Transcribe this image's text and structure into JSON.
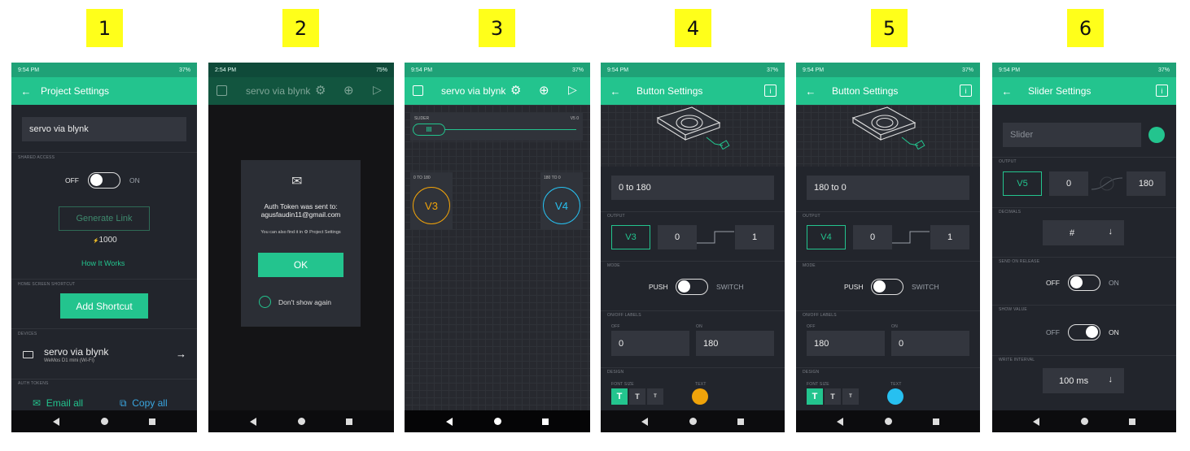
{
  "badges": [
    "1",
    "2",
    "3",
    "4",
    "5",
    "6"
  ],
  "colors": {
    "accent": "#23c48e",
    "badge": "#ffff1a",
    "orange": "#f0a30a",
    "blue": "#27c0f0"
  },
  "p1": {
    "status_time": "9:54 PM",
    "status_right": "37%",
    "title": "Project Settings",
    "project_name": "servo via blynk",
    "shared_access_label": "SHARED ACCESS",
    "off": "OFF",
    "on": "ON",
    "generate_link": "Generate Link",
    "energy": "1000",
    "how_it_works": "How It Works",
    "home_shortcut_label": "HOME SCREEN SHORTCUT",
    "add_shortcut": "Add Shortcut",
    "devices_label": "DEVICES",
    "device_name": "servo via blynk",
    "device_model": "WeMos D1 mini (Wi-Fi)",
    "auth_tokens_label": "AUTH TOKENS",
    "email_all": "Email all",
    "copy_all": "Copy all"
  },
  "p2": {
    "status_time": "2:54 PM",
    "status_right": "75%",
    "title": "servo via blynk",
    "dialog_line1": "Auth Token was sent to:",
    "dialog_email": "agusfaudin11@gmail.com",
    "dialog_hint": "You can also find it in",
    "dialog_hint_link": "Project Settings",
    "ok": "OK",
    "dont_show": "Don't show again"
  },
  "p3": {
    "status_time": "9:54 PM",
    "status_right": "37%",
    "title": "servo via blynk",
    "slider_label": "SLIDER",
    "slider_pin": "V5 0",
    "btn1_label": "0 TO 180",
    "btn1_pin": "V3",
    "btn2_label": "180 TO 0",
    "btn2_pin": "V4"
  },
  "p4": {
    "status_time": "9:54 PM",
    "status_right": "37%",
    "title": "Button Settings",
    "name": "0 to 180",
    "output_label": "OUTPUT",
    "pin": "V3",
    "min": "0",
    "max": "1",
    "mode_label": "MODE",
    "push": "PUSH",
    "switch": "SWITCH",
    "onoff_label": "ON/OFF LABELS",
    "off_sub": "OFF",
    "on_sub": "ON",
    "off_value": "0",
    "on_value": "180",
    "design_label": "DESIGN",
    "font_size_label": "FONT SIZE",
    "text_label": "TEXT",
    "font_t": "T"
  },
  "p5": {
    "status_time": "9:54 PM",
    "status_right": "37%",
    "title": "Button Settings",
    "name": "180 to 0",
    "output_label": "OUTPUT",
    "pin": "V4",
    "min": "0",
    "max": "1",
    "mode_label": "MODE",
    "push": "PUSH",
    "switch": "SWITCH",
    "onoff_label": "ON/OFF LABELS",
    "off_sub": "OFF",
    "on_sub": "ON",
    "off_value": "180",
    "on_value": "0",
    "design_label": "DESIGN",
    "font_size_label": "FONT SIZE",
    "text_label": "TEXT",
    "font_t": "T"
  },
  "p6": {
    "status_time": "9:54 PM",
    "status_right": "37%",
    "title": "Slider Settings",
    "name_placeholder": "Slider",
    "output_label": "OUTPUT",
    "pin": "V5",
    "min": "0",
    "max": "180",
    "decimals_label": "DECIMALS",
    "decimals_value": "#",
    "send_release_label": "SEND ON RELEASE",
    "show_value_label": "SHOW VALUE",
    "write_interval_label": "WRITE INTERVAL",
    "write_interval_value": "100 ms",
    "off": "OFF",
    "on": "ON"
  }
}
